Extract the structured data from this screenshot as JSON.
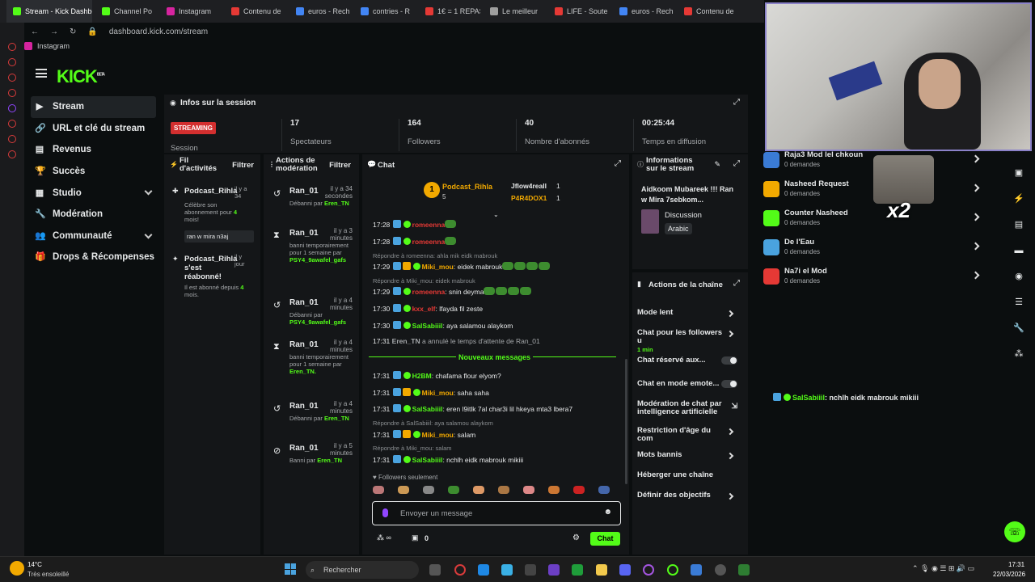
{
  "browser": {
    "tabs": [
      "Stream - Kick Dashbo",
      "Channel Po",
      "Instagram",
      "Contenu de",
      "euros - Rech",
      "contries - R",
      "1€ = 1 REPAS",
      "Le meilleur",
      "LIFE - Soute",
      "euros - Rech",
      "Contenu de"
    ],
    "url": "dashboard.kick.com/stream",
    "bookmark": "Instagram"
  },
  "logo": "KICK",
  "logo_sup": "BETA",
  "nav": [
    {
      "label": "Stream",
      "icon": "▶"
    },
    {
      "label": "URL et clé du stream",
      "icon": "🔗"
    },
    {
      "label": "Revenus",
      "icon": "▤"
    },
    {
      "label": "Succès",
      "icon": "🏆"
    },
    {
      "label": "Studio",
      "icon": "▦"
    },
    {
      "label": "Modération",
      "icon": "🔧"
    },
    {
      "label": "Communauté",
      "icon": "👥"
    },
    {
      "label": "Drops & Récompenses",
      "icon": "🎁"
    }
  ],
  "session": {
    "title": "Infos sur la session",
    "live": "STREAMING",
    "session_label": "Session",
    "stats": [
      {
        "value": "17",
        "label": "Spectateurs"
      },
      {
        "value": "164",
        "label": "Followers"
      },
      {
        "value": "40",
        "label": "Nombre d'abonnés"
      },
      {
        "value": "00:25:44",
        "label": "Temps en diffusion"
      }
    ]
  },
  "activity": {
    "title": "Fil d'activités",
    "filter": "Filtrer",
    "items": [
      {
        "name": "Podcast_Rihla",
        "time": "il y a 34",
        "desc_pre": "Célèbre son abonnement pour ",
        "desc_num": "4",
        "desc_post": " mois!",
        "note": "ran w mira n3aj"
      },
      {
        "name": "Podcast_Rihla s'est réabonné!",
        "time": "il y jour",
        "desc_pre": "Il est abonné depuis ",
        "desc_num": "4",
        "desc_post": " mois."
      }
    ]
  },
  "moderation": {
    "title": "Actions de modération",
    "filter": "Filtrer",
    "items": [
      {
        "icon": "↺",
        "name": "Ran_01",
        "time": "il y a 34 secondes",
        "desc": "Débanni par",
        "user": "Eren_TN"
      },
      {
        "icon": "⧗",
        "name": "Ran_01",
        "time": "il y a 3 minutes",
        "desc": "banni temporairement pour 1 semaine par",
        "user": "PSY4_9awafel_gafs"
      },
      {
        "icon": "↺",
        "name": "Ran_01",
        "time": "il y a 4 minutes",
        "desc": "Débanni par",
        "user": "PSY4_9awafel_gafs"
      },
      {
        "icon": "⧗",
        "name": "Ran_01",
        "time": "il y a 4 minutes",
        "desc": "banni temporairement pour 1 semaine par",
        "user": "Eren_TN."
      },
      {
        "icon": "↺",
        "name": "Ran_01",
        "time": "il y a 4 minutes",
        "desc": "Débanni par",
        "user": "Eren_TN"
      },
      {
        "icon": "⊘",
        "name": "Ran_01",
        "time": "il y a 5 minutes",
        "desc": "Banni par",
        "user": "Eren_TN"
      }
    ]
  },
  "chat": {
    "title": "Chat",
    "top_gifters": [
      {
        "name": "Podcast_Rihla",
        "count": "5"
      },
      {
        "name": "Jflow4reall",
        "count": "1"
      },
      {
        "name": "P4R4DOX1",
        "count": "1"
      }
    ],
    "messages": [
      {
        "time": "17:28",
        "user": "romeenna",
        "text": "",
        "color": "#e53935"
      },
      {
        "time": "17:28",
        "user": "romeenna",
        "text": "",
        "color": "#e53935"
      },
      {
        "reply": "Répondre à romeenna: ahla mik eidk mabrouk"
      },
      {
        "time": "17:29",
        "user": "Miki_mou",
        "text": ": eidek mabrouk",
        "color": "#f2a900"
      },
      {
        "reply": "Répondre à Miki_mou: eidek mabrouk"
      },
      {
        "time": "17:29",
        "user": "romeenna",
        "text": ": snin deyma",
        "color": "#e53935"
      },
      {
        "time": "17:30",
        "user": "kxx_elf",
        "text": ": lfayda fil zeste",
        "color": "#e53935"
      },
      {
        "time": "17:30",
        "user": "SalSabiiil",
        "text": ": aya salamou alaykom",
        "color": "#53fc18"
      },
      {
        "time": "17:31",
        "user": "Eren_TN",
        "text": "a annulé le temps d'attente de Ran_01",
        "color": "#a6a9ac"
      },
      {
        "time": "17:31",
        "user": "H2BM",
        "text": ": chafama flour elyom?",
        "color": "#53fc18"
      },
      {
        "time": "17:31",
        "user": "Miki_mou",
        "text": ": saha saha",
        "color": "#f2a900"
      },
      {
        "time": "17:31",
        "user": "SalSabiiil",
        "text": ": eren l9itlk 7al char3i lil hkeya mta3 lbera7",
        "color": "#53fc18"
      },
      {
        "reply": "Répondre à SalSabiiil: aya salamou alaykom"
      },
      {
        "time": "17:31",
        "user": "Miki_mou",
        "text": ": salam",
        "color": "#f2a900"
      },
      {
        "reply": "Répondre à Miki_mou: salam"
      },
      {
        "time": "17:31",
        "user": "SalSabiiil",
        "text": ": nchlh eidk mabrouk mikiii",
        "color": "#53fc18"
      }
    ],
    "new_messages": "Nouveaux messages",
    "followers_only": "Followers seulement",
    "placeholder": "Envoyer un message",
    "count": "0",
    "send": "Chat"
  },
  "stream_info": {
    "title": "Informations sur le stream",
    "stream_title": "Aidkoom Mubareek !!! Ran w Mira 7sebkom...",
    "category": "Discussion",
    "tag": "Arabic"
  },
  "chat_actions": {
    "title": "Actions de la chaîne",
    "items": [
      {
        "label": "Mode lent",
        "type": "arrow"
      },
      {
        "label": "Chat pour les followers u",
        "sub": "1 min",
        "type": "arrow"
      },
      {
        "label": "Chat réservé aux...",
        "type": "toggle"
      },
      {
        "label": "Chat en mode emote...",
        "type": "toggle"
      },
      {
        "label": "Modération de chat par intelligence artificielle",
        "type": "ext"
      },
      {
        "label": "Restriction d'âge du com",
        "type": "arrow"
      },
      {
        "label": "Mots bannis",
        "type": "arrow"
      },
      {
        "label": "Héberger une chaîne",
        "type": "none"
      },
      {
        "label": "Définir des objectifs",
        "type": "arrow"
      }
    ]
  },
  "rewards": [
    {
      "title": "Raja3 Mod lel chkoun",
      "sub": "0 demandes",
      "color": "#3a7bd5"
    },
    {
      "title": "Nasheed Request",
      "sub": "0 demandes",
      "color": "#f2a900"
    },
    {
      "title": "Counter Nasheed",
      "sub": "0 demandes",
      "color": "#53fc18"
    },
    {
      "title": "De l'Eau",
      "sub": "0 demandes",
      "color": "#4aa3df"
    },
    {
      "title": "Na7i el Mod",
      "sub": "0 demandes",
      "color": "#e53935"
    }
  ],
  "overlay": {
    "text": "x2",
    "chat_user": "SalSabiiil",
    "chat_text": ": nchlh eidk mabrouk mikiii"
  },
  "taskbar": {
    "temp": "14°C",
    "weather": "Très ensoleillé",
    "search": "Rechercher",
    "time": "17:31",
    "date": "22/03/2026"
  }
}
